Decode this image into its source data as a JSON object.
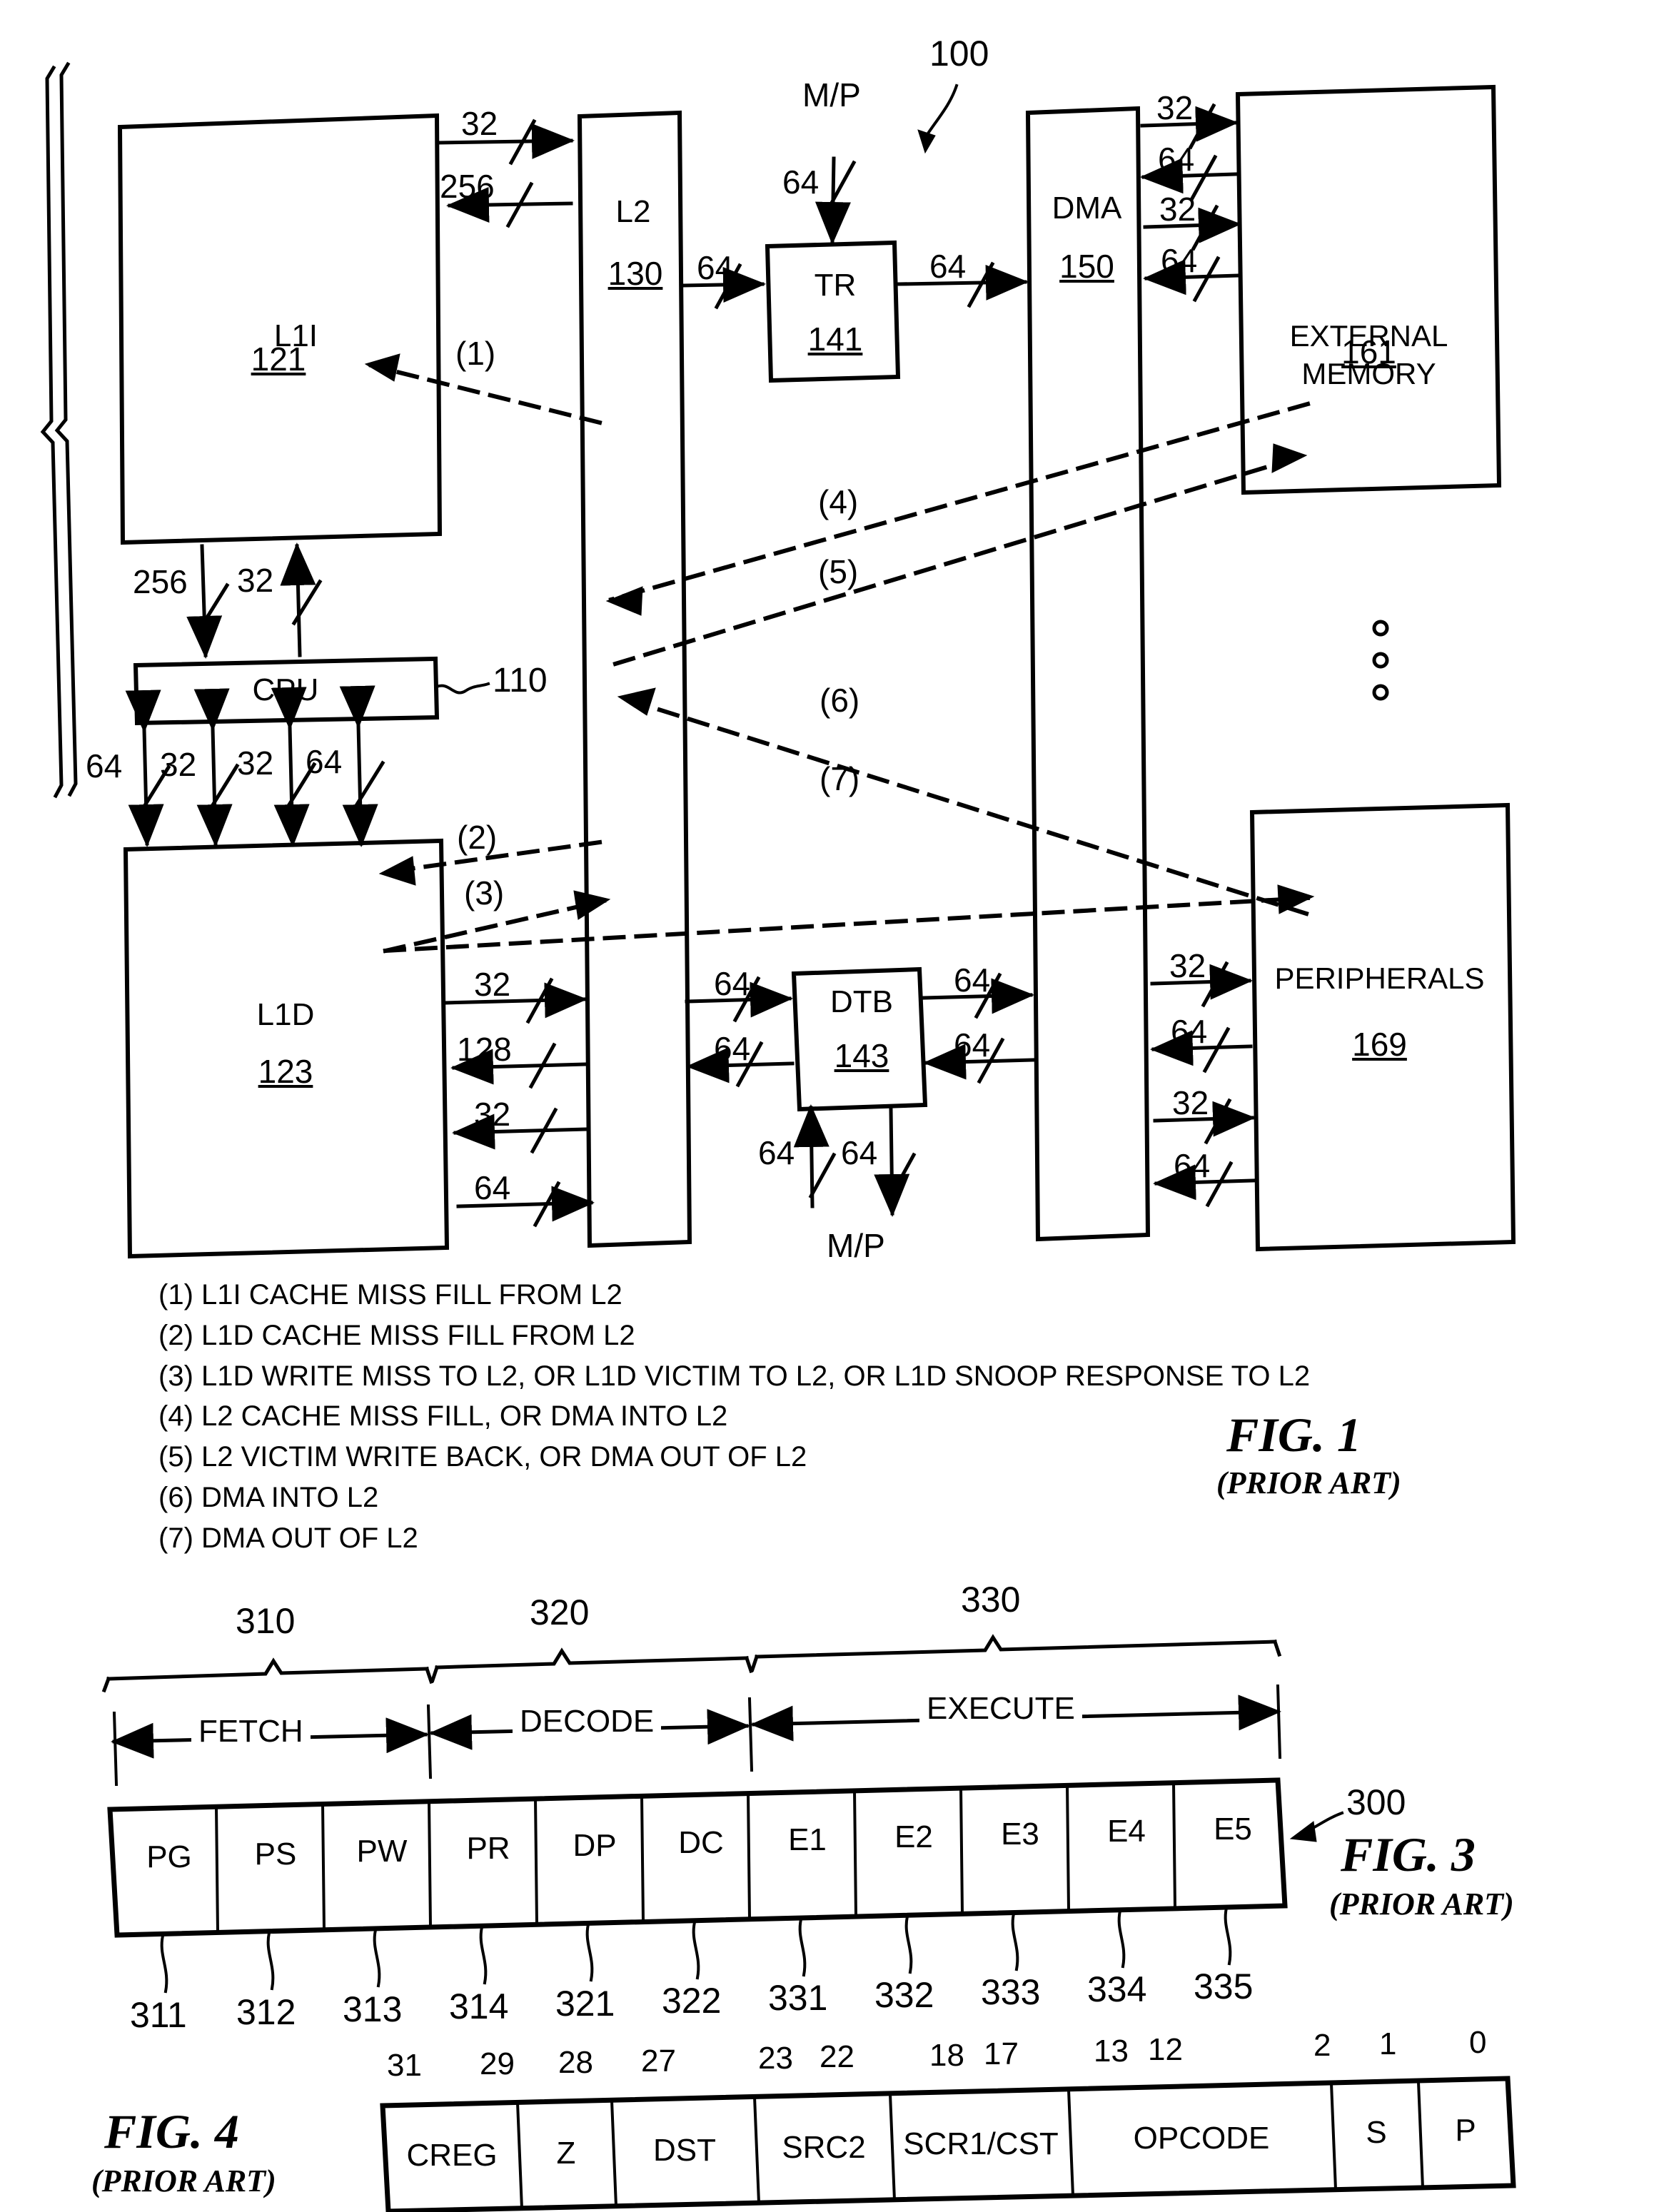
{
  "sheet": {
    "figures": [
      "FIG. 1",
      "FIG. 3",
      "FIG. 4"
    ]
  },
  "fig1": {
    "title": "FIG. 1",
    "subtitle": "(PRIOR ART)",
    "system_ref": "100",
    "blocks": [
      {
        "id": "l1i",
        "name": "L1I",
        "ref": "121"
      },
      {
        "id": "cpu",
        "name": "CPU",
        "ref": "110"
      },
      {
        "id": "l1d",
        "name": "L1D",
        "ref": "123"
      },
      {
        "id": "l2",
        "name": "L2",
        "ref": "130"
      },
      {
        "id": "tr",
        "name": "TR",
        "ref": "141"
      },
      {
        "id": "dtb",
        "name": "DTB",
        "ref": "143"
      },
      {
        "id": "dma",
        "name": "DMA",
        "ref": "150"
      },
      {
        "id": "emem",
        "name": "EXTERNAL MEMORY",
        "ref": "161"
      },
      {
        "id": "per",
        "name": "PERIPHERALS",
        "ref": "169"
      }
    ],
    "bus_widths": {
      "l1i_to_l2": "32",
      "l2_to_l1i": "256",
      "l1i_to_cpu": "256",
      "cpu_to_l1i": "32",
      "cpu_l1d_a": "64",
      "cpu_l1d_b": "32",
      "cpu_l1d_c": "32",
      "cpu_l1d_d": "64",
      "l1d_to_l2_1": "32",
      "l2_to_l1d_1": "128",
      "l2_to_l1d_2": "32",
      "l1d_to_l2_2": "64",
      "l2_to_tr": "64",
      "tr_to_dma": "64",
      "mp_to_tr": "64",
      "l2_to_dtb": "64",
      "dtb_to_l2": "64",
      "dtb_to_dma": "64",
      "dma_to_dtb": "64",
      "dtb_mp_in": "64",
      "dtb_mp_out": "64",
      "dma_to_emem_1": "32",
      "emem_to_dma_1": "64",
      "dma_to_emem_2": "32",
      "emem_to_dma_2": "64",
      "dma_to_per_1": "32",
      "per_to_dma_1": "64",
      "dma_to_per_2": "32",
      "per_to_dma_2": "64"
    },
    "mp_top": "M/P",
    "mp_bottom": "M/P",
    "flow_markers": [
      "(1)",
      "(2)",
      "(3)",
      "(4)",
      "(5)",
      "(6)",
      "(7)"
    ],
    "legend": [
      "(1) L1I CACHE MISS FILL FROM L2",
      "(2) L1D CACHE MISS FILL FROM L2",
      "(3) L1D WRITE MISS TO L2, OR L1D VICTIM TO L2, OR L1D SNOOP RESPONSE TO L2",
      "(4) L2 CACHE MISS FILL, OR DMA INTO L2",
      "(5) L2 VICTIM WRITE BACK, OR DMA OUT OF L2",
      "(6) DMA INTO L2",
      "(7) DMA OUT OF L2"
    ]
  },
  "fig3": {
    "title": "FIG. 3",
    "subtitle": "(PRIOR ART)",
    "pipeline_ref": "300",
    "phase_refs": {
      "fetch": "310",
      "decode": "320",
      "execute": "330"
    },
    "phase_names": {
      "fetch": "FETCH",
      "decode": "DECODE",
      "execute": "EXECUTE"
    },
    "stages": [
      {
        "label": "PG",
        "ref": "311"
      },
      {
        "label": "PS",
        "ref": "312"
      },
      {
        "label": "PW",
        "ref": "313"
      },
      {
        "label": "PR",
        "ref": "314"
      },
      {
        "label": "DP",
        "ref": "321"
      },
      {
        "label": "DC",
        "ref": "322"
      },
      {
        "label": "E1",
        "ref": "331"
      },
      {
        "label": "E2",
        "ref": "332"
      },
      {
        "label": "E3",
        "ref": "333"
      },
      {
        "label": "E4",
        "ref": "334"
      },
      {
        "label": "E5",
        "ref": "335"
      }
    ]
  },
  "fig4": {
    "title": "FIG. 4",
    "subtitle": "(PRIOR ART)",
    "fields": [
      {
        "label": "CREG",
        "hi": "31",
        "lo": "29"
      },
      {
        "label": "Z",
        "hi": "28",
        "lo": ""
      },
      {
        "label": "DST",
        "hi": "27",
        "lo": "23"
      },
      {
        "label": "SRC2",
        "hi": "22",
        "lo": "18"
      },
      {
        "label": "SCR1/CST",
        "hi": "17",
        "lo": "13"
      },
      {
        "label": "OPCODE",
        "hi": "12",
        "lo": "2"
      },
      {
        "label": "S",
        "hi": "1",
        "lo": ""
      },
      {
        "label": "P",
        "hi": "0",
        "lo": ""
      }
    ],
    "bit_ticks": [
      "31",
      "29",
      "28",
      "27",
      "23",
      "22",
      "18",
      "17",
      "13",
      "12",
      "2",
      "1",
      "0"
    ]
  }
}
